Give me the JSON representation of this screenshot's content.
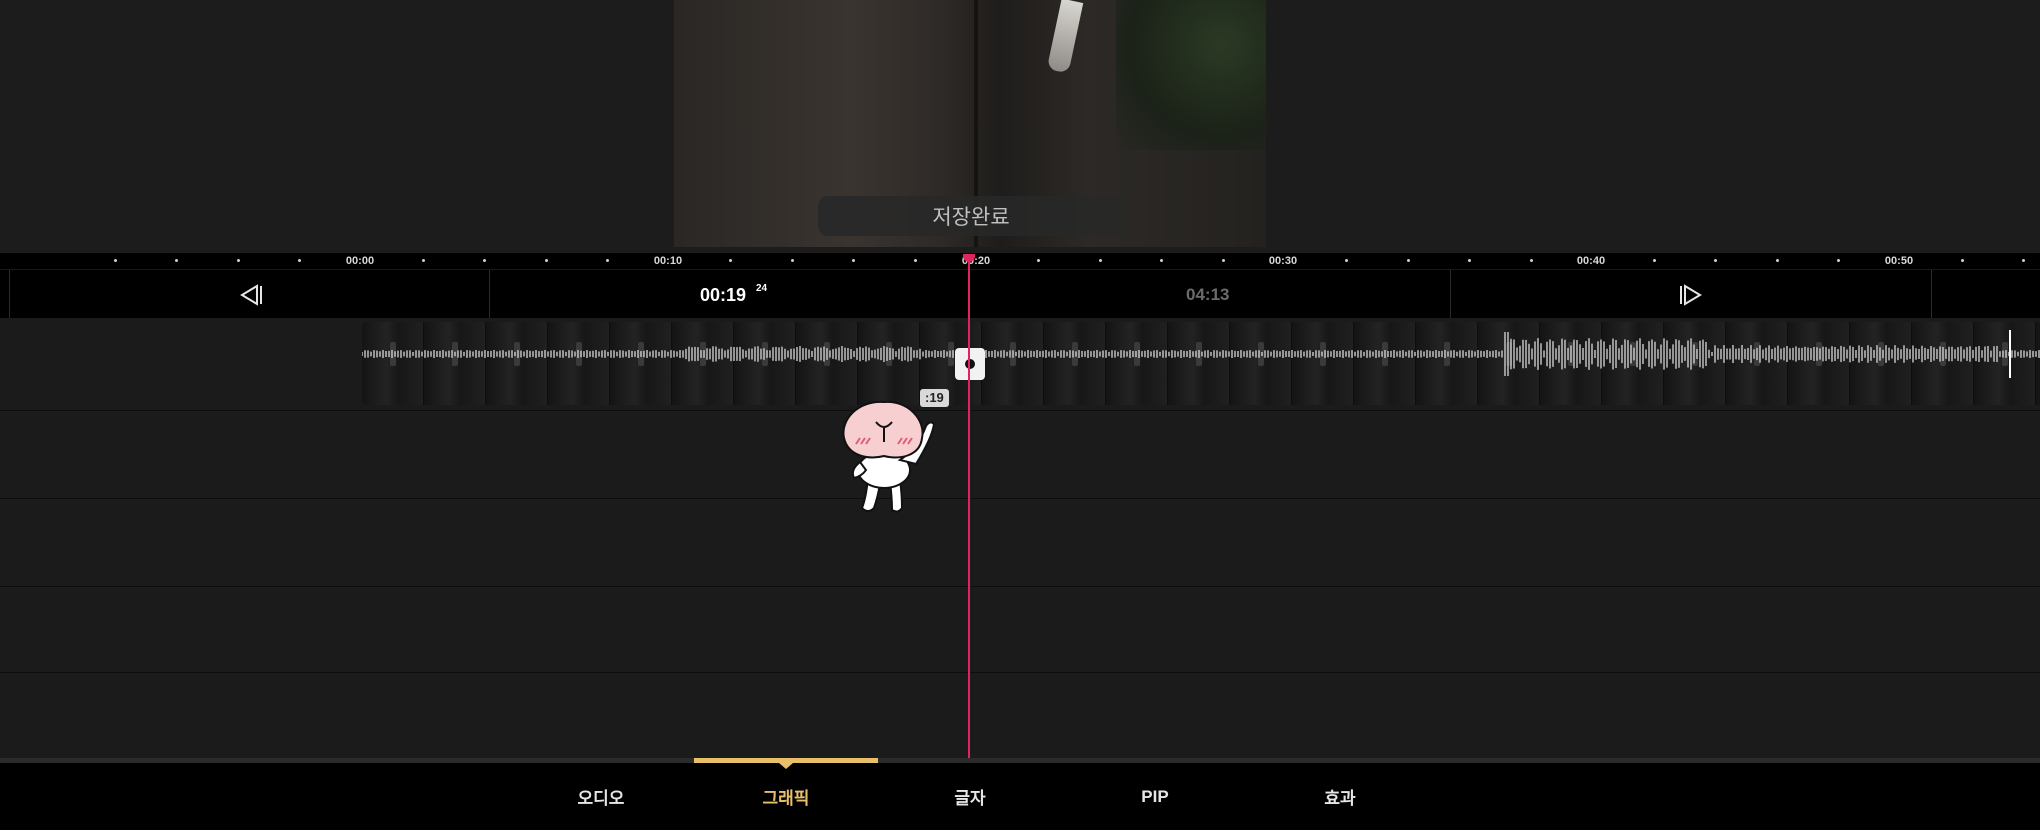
{
  "preview": {
    "toast_text": "저장완료"
  },
  "ruler": {
    "labels": [
      "00:00",
      "00:10",
      "00:20",
      "00:30",
      "00:40",
      "00:50"
    ]
  },
  "controls": {
    "prev_frame_icon": "step-back-icon",
    "next_frame_icon": "step-forward-icon",
    "current_time": "00:19",
    "current_frame": "24",
    "total_time": "04:13"
  },
  "timeline": {
    "clip_time_badge": ":19",
    "playhead_color": "#e0245e"
  },
  "tabs": [
    {
      "label": "오디오",
      "active": false
    },
    {
      "label": "그래픽",
      "active": true
    },
    {
      "label": "글자",
      "active": false
    },
    {
      "label": "PIP",
      "active": false
    },
    {
      "label": "효과",
      "active": false
    }
  ],
  "colors": {
    "accent": "#e8c06a",
    "playhead": "#e0245e",
    "background": "#1c1c1c"
  }
}
